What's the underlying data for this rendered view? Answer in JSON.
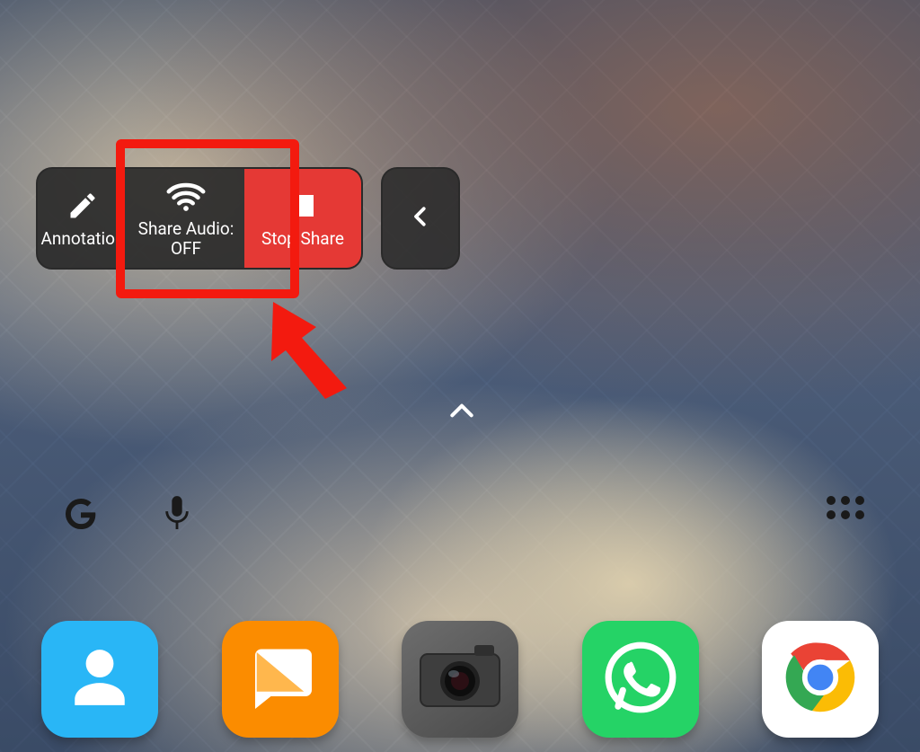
{
  "toolbar": {
    "annotation_label": "Annotation",
    "share_audio_label": "Share Audio:\nOFF",
    "stop_share_label": "Stop Share"
  },
  "dock": {
    "contacts_name": "Contacts",
    "messages_name": "Messages",
    "camera_name": "Camera",
    "whatsapp_name": "WhatsApp",
    "chrome_name": "Chrome"
  },
  "annotation": {
    "purpose": "highlight-share-audio-button"
  }
}
